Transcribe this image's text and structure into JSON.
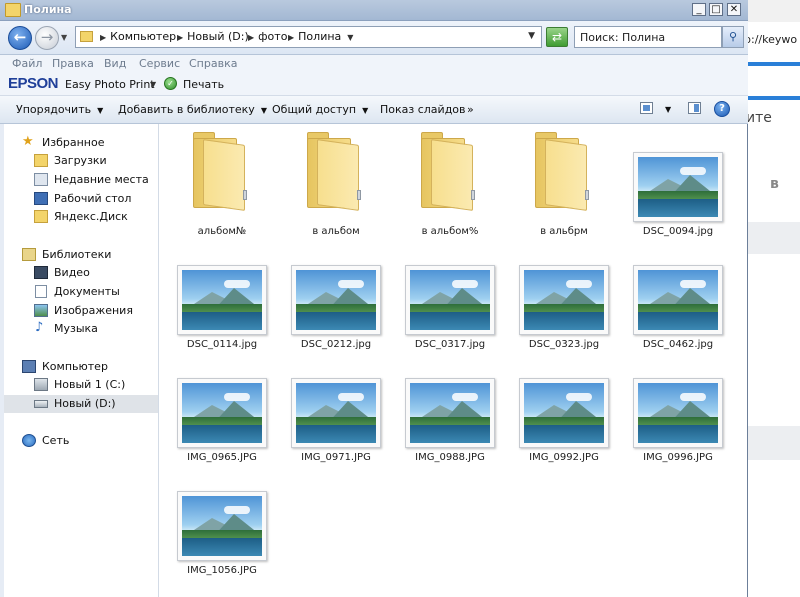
{
  "window": {
    "title": "Полина"
  },
  "nav": {
    "back_icon": "back-arrow-icon",
    "forward_icon": "forward-arrow-icon"
  },
  "address": {
    "crumbs": [
      "Компьютер",
      "Новый (D:)",
      "фото",
      "Полина"
    ]
  },
  "search": {
    "value": "Поиск: Полина"
  },
  "menu": [
    "Файл",
    "Правка",
    "Вид",
    "Сервис",
    "Справка"
  ],
  "epson": {
    "brand": "EPSON",
    "app": "Easy Photo Print",
    "print": "Печать"
  },
  "commands": {
    "organize": "Упорядочить",
    "add_library": "Добавить в библиотеку",
    "share": "Общий доступ",
    "slideshow": "Показ слайдов",
    "more": "»"
  },
  "sidebar": {
    "favorites": {
      "header": "Избранное",
      "items": [
        "Загрузки",
        "Недавние места",
        "Рабочий стол",
        "Яндекс.Диск"
      ]
    },
    "libraries": {
      "header": "Библиотеки",
      "items": [
        "Видео",
        "Документы",
        "Изображения",
        "Музыка"
      ]
    },
    "computer": {
      "header": "Компьютер",
      "items": [
        "Новый 1 (C:)",
        "Новый (D:)"
      ],
      "selected": "Новый (D:)"
    },
    "network": {
      "header": "Сеть"
    }
  },
  "files": [
    {
      "name": "альбом№",
      "type": "folder"
    },
    {
      "name": "в альбом",
      "type": "folder"
    },
    {
      "name": "в альбом%",
      "type": "folder"
    },
    {
      "name": "в альбрм",
      "type": "folder"
    },
    {
      "name": "DSC_0094.jpg",
      "type": "image"
    },
    {
      "name": "DSC_0114.jpg",
      "type": "image"
    },
    {
      "name": "DSC_0212.jpg",
      "type": "image"
    },
    {
      "name": "DSC_0317.jpg",
      "type": "image"
    },
    {
      "name": "DSC_0323.jpg",
      "type": "image"
    },
    {
      "name": "DSC_0462.jpg",
      "type": "image"
    },
    {
      "name": "IMG_0965.JPG",
      "type": "image"
    },
    {
      "name": "IMG_0971.JPG",
      "type": "image"
    },
    {
      "name": "IMG_0988.JPG",
      "type": "image"
    },
    {
      "name": "IMG_0992.JPG",
      "type": "image"
    },
    {
      "name": "IMG_0996.JPG",
      "type": "image"
    },
    {
      "name": "IMG_1056.JPG",
      "type": "image"
    }
  ],
  "right_panel": {
    "url_text": "p://keywo",
    "text1": "ите",
    "text2": "в"
  },
  "colors": {
    "accent_blue": "#1d5bb6",
    "selection": "#dfe3e8",
    "folder_yellow": "#f3d46a"
  }
}
